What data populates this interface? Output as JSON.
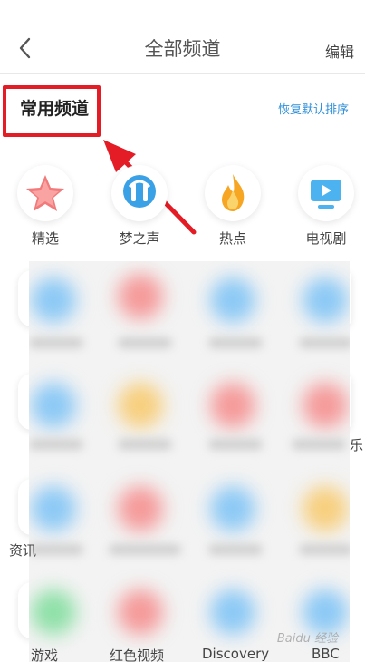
{
  "header": {
    "title": "全部频道",
    "edit_label": "编辑"
  },
  "section": {
    "heading": "常用频道",
    "reset_label": "恢复默认排序"
  },
  "channels": [
    {
      "label": "精选",
      "icon": "star-icon"
    },
    {
      "label": "梦之声",
      "icon": "microphone-icon"
    },
    {
      "label": "热点",
      "icon": "flame-icon"
    },
    {
      "label": "电视剧",
      "icon": "tv-icon"
    }
  ],
  "partial_labels": {
    "right_row3": "乐",
    "left_row4": "资讯",
    "bottom": [
      "游戏",
      "红色视频",
      "Discovery",
      "BBC"
    ]
  },
  "watermark": "Baidu 经验",
  "colors": {
    "accent_blue": "#2f8fd8",
    "annotation_red": "#e31c25"
  }
}
